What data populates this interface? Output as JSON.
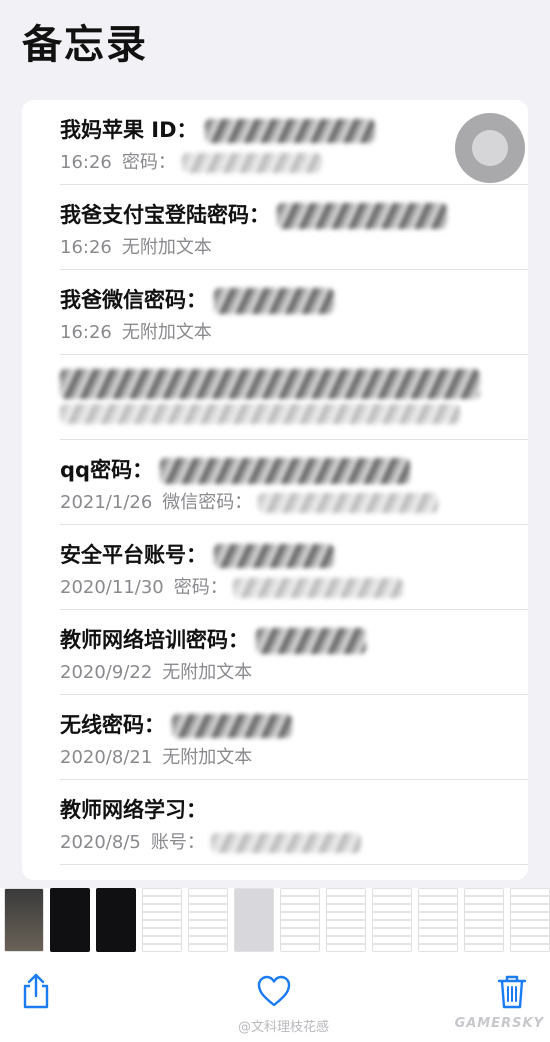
{
  "header": {
    "title": "备忘录"
  },
  "notes": [
    {
      "title": "我妈苹果 ID：",
      "date": "16:26",
      "snippet": "密码："
    },
    {
      "title": "我爸支付宝登陆密码：",
      "date": "16:26",
      "snippet": "无附加文本"
    },
    {
      "title": "我爸微信密码：",
      "date": "16:26",
      "snippet": "无附加文本"
    },
    {
      "title": "",
      "date": "",
      "snippet": ""
    },
    {
      "title": "qq密码：",
      "date": "2021/1/26",
      "snippet": "微信密码："
    },
    {
      "title": "安全平台账号：",
      "date": "2020/11/30",
      "snippet": "密码："
    },
    {
      "title": "教师网络培训密码：",
      "date": "2020/9/22",
      "snippet": "无附加文本"
    },
    {
      "title": "无线密码：",
      "date": "2020/8/21",
      "snippet": "无附加文本"
    },
    {
      "title": "教师网络学习：",
      "date": "2020/8/5",
      "snippet": "账号："
    }
  ],
  "toolbar": {
    "share_icon": "share-icon",
    "like_icon": "heart-icon",
    "delete_icon": "trash-icon"
  },
  "watermark": {
    "left": "@文科理枝花感",
    "right": "GAMERSKY"
  },
  "colors": {
    "accent": "#1a7bf2",
    "background": "#f2f2f6",
    "secondary_text": "#8a8a8e"
  }
}
